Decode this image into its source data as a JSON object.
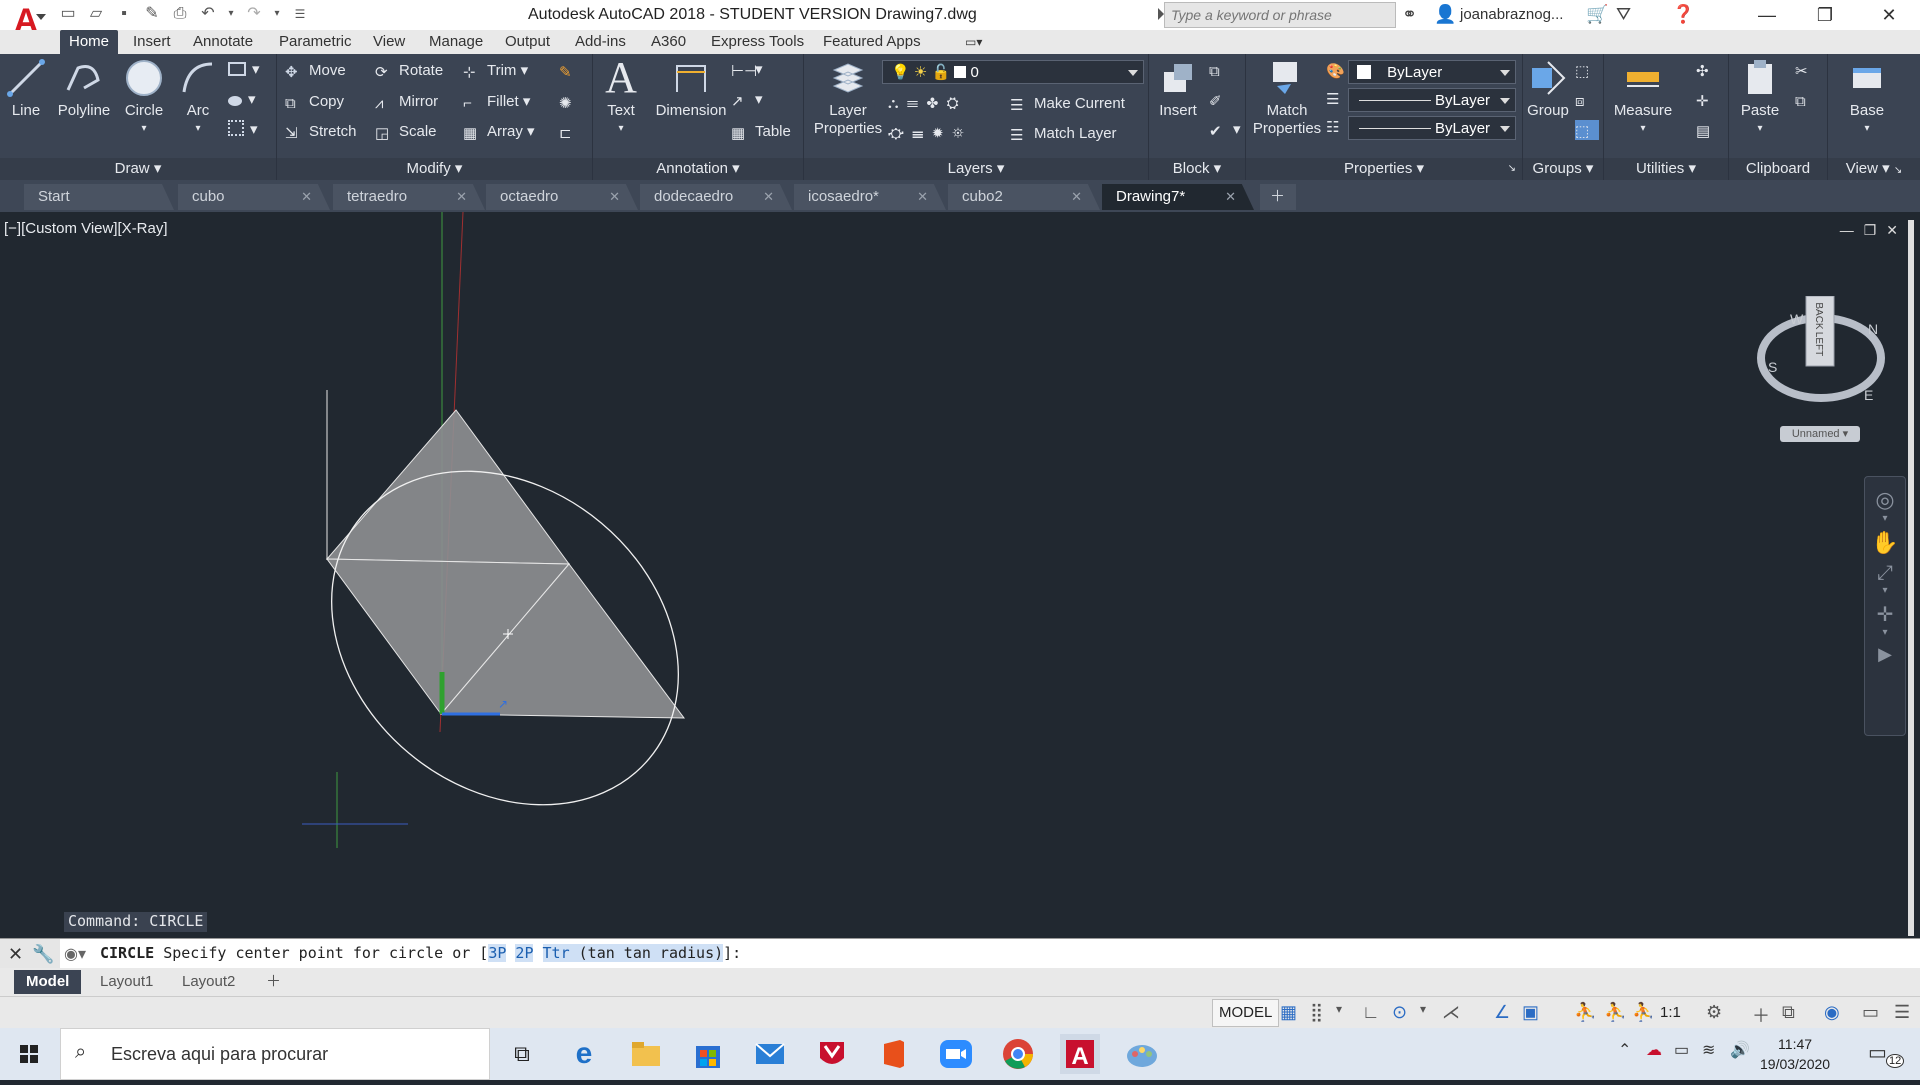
{
  "app": {
    "logo_letter": "A",
    "window_title": "Autodesk AutoCAD 2018 - STUDENT VERSION    Drawing7.dwg",
    "search_placeholder": "Type a keyword or phrase",
    "user_name": "joanabraznog...",
    "accent_color": "#d71921"
  },
  "ribbon_tabs": [
    "Home",
    "Insert",
    "Annotate",
    "Parametric",
    "View",
    "Manage",
    "Output",
    "Add-ins",
    "A360",
    "Express Tools",
    "Featured Apps"
  ],
  "ribbon": {
    "draw": {
      "title": "Draw",
      "line": "Line",
      "polyline": "Polyline",
      "circle": "Circle",
      "arc": "Arc"
    },
    "modify": {
      "title": "Modify",
      "move": "Move",
      "rotate": "Rotate",
      "trim": "Trim",
      "copy": "Copy",
      "mirror": "Mirror",
      "fillet": "Fillet",
      "stretch": "Stretch",
      "scale": "Scale",
      "array": "Array"
    },
    "annotation": {
      "title": "Annotation",
      "text": "Text",
      "dimension": "Dimension",
      "table": "Table"
    },
    "layers": {
      "title": "Layers",
      "layer_properties_1": "Layer",
      "layer_properties_2": "Properties",
      "current_layer": "0",
      "make_current": "Make Current",
      "match_layer": "Match Layer"
    },
    "block": {
      "title": "Block",
      "insert": "Insert"
    },
    "properties": {
      "title": "Properties",
      "match_1": "Match",
      "match_2": "Properties",
      "color": "ByLayer",
      "linetype": "ByLayer",
      "lineweight": "ByLayer"
    },
    "groups": {
      "title": "Groups",
      "group": "Group"
    },
    "utilities": {
      "title": "Utilities",
      "measure": "Measure"
    },
    "clipboard": {
      "title": "Clipboard",
      "paste": "Paste"
    },
    "view": {
      "title": "View",
      "base": "Base"
    }
  },
  "file_tabs": [
    "Start",
    "cubo",
    "tetraedro",
    "octaedro",
    "dodecaedro",
    "icosaedro*",
    "cubo2",
    "Drawing7*"
  ],
  "viewport": {
    "label": "[−][Custom View][X-Ray]",
    "viewcube_top": "BACK",
    "viewcube_side": "LEFT",
    "compass": {
      "n": "N",
      "s": "S",
      "e": "E",
      "w": "W"
    },
    "ucs_name": "Unnamed"
  },
  "command": {
    "history": "Command: CIRCLE",
    "name": "CIRCLE",
    "prompt": "Specify center point for circle or [",
    "opt1": "3P",
    "opt2": "2P",
    "opt3": "Ttr",
    "opt3_rest": " (tan tan radius)",
    "end": "]:"
  },
  "layout_tabs": [
    "Model",
    "Layout1",
    "Layout2"
  ],
  "status": {
    "model": "MODEL",
    "scale": "1:1"
  },
  "taskbar": {
    "search_text": "Escreva aqui para procurar",
    "time": "11:47",
    "date": "19/03/2020",
    "notifications": "12"
  }
}
